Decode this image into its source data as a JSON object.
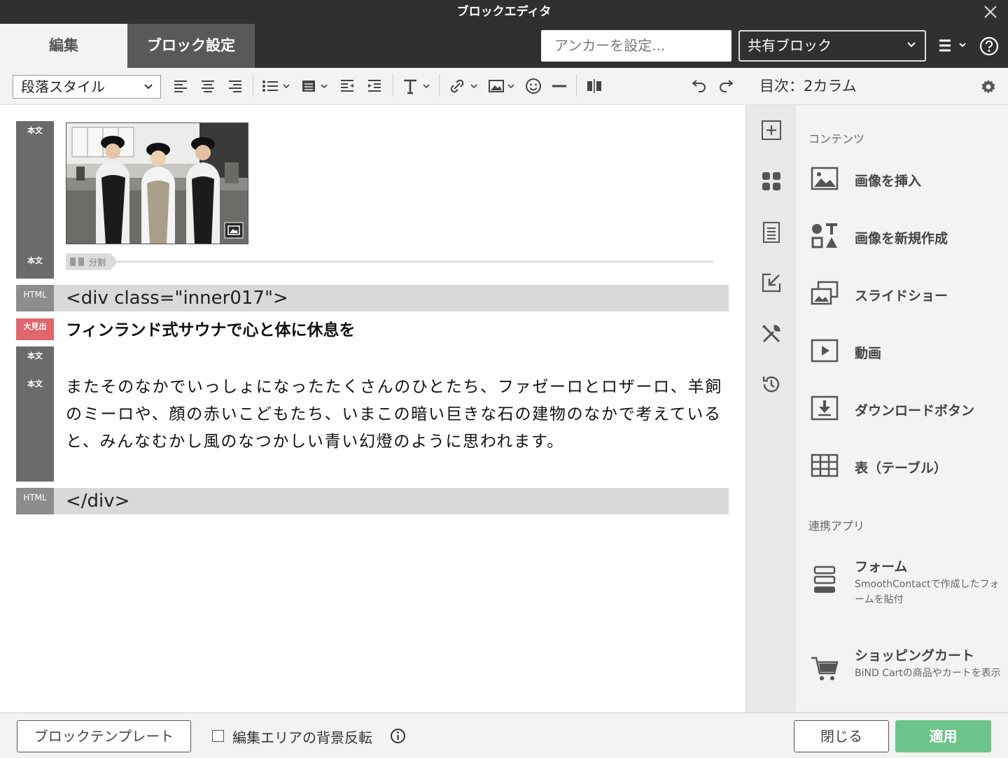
{
  "window": {
    "title": "ブロックエディタ"
  },
  "tabs": {
    "edit": "編集",
    "block_settings": "ブロック設定"
  },
  "anchor": {
    "placeholder": "アンカーを設定..."
  },
  "shared_block": {
    "value": "共有ブロック"
  },
  "toolbar": {
    "paragraph_style": "段落スタイル"
  },
  "right_header": {
    "title": "目次：2カラム"
  },
  "editor": {
    "labels": {
      "body": "本文",
      "html": "HTML",
      "heading": "大見出"
    },
    "split_label": "分割",
    "html_open": "<div class=\"inner017\">",
    "heading": "フィンランド式サウナで心と体に休息を",
    "paragraph": "またそのなかでいっしょになったたくさんのひとたち、ファゼーロとロザーロ、羊飼のミーロや、顔の赤いこどもたち、いまこの暗い巨きな石の建物のなかで考えていると、みんなむかし風のなつかしい青い幻燈のように思われます。",
    "html_close": "</div>"
  },
  "panel": {
    "contents_label": "コンテンツ",
    "items": [
      {
        "label": "画像を挿入"
      },
      {
        "label": "画像を新規作成"
      },
      {
        "label": "スライドショー"
      },
      {
        "label": "動画"
      },
      {
        "label": "ダウンロードボタン"
      },
      {
        "label": "表（テーブル）"
      }
    ],
    "apps_label": "連携アプリ",
    "apps": [
      {
        "label": "フォーム",
        "desc": "SmoothContactで作成したフォームを貼付"
      },
      {
        "label": "ショッピングカート",
        "desc": "BiND Cartの商品やカートを表示"
      }
    ]
  },
  "footer": {
    "template_button": "ブロックテンプレート",
    "invert_label": "編集エリアの背景反転",
    "close_button": "閉じる",
    "apply_button": "適用"
  },
  "colors": {
    "dark_bar": "#303030",
    "active_tab": "#595959",
    "apply": "#6cc48a",
    "heading_label": "#e0666d",
    "label_gray": "#6b6b6b"
  }
}
